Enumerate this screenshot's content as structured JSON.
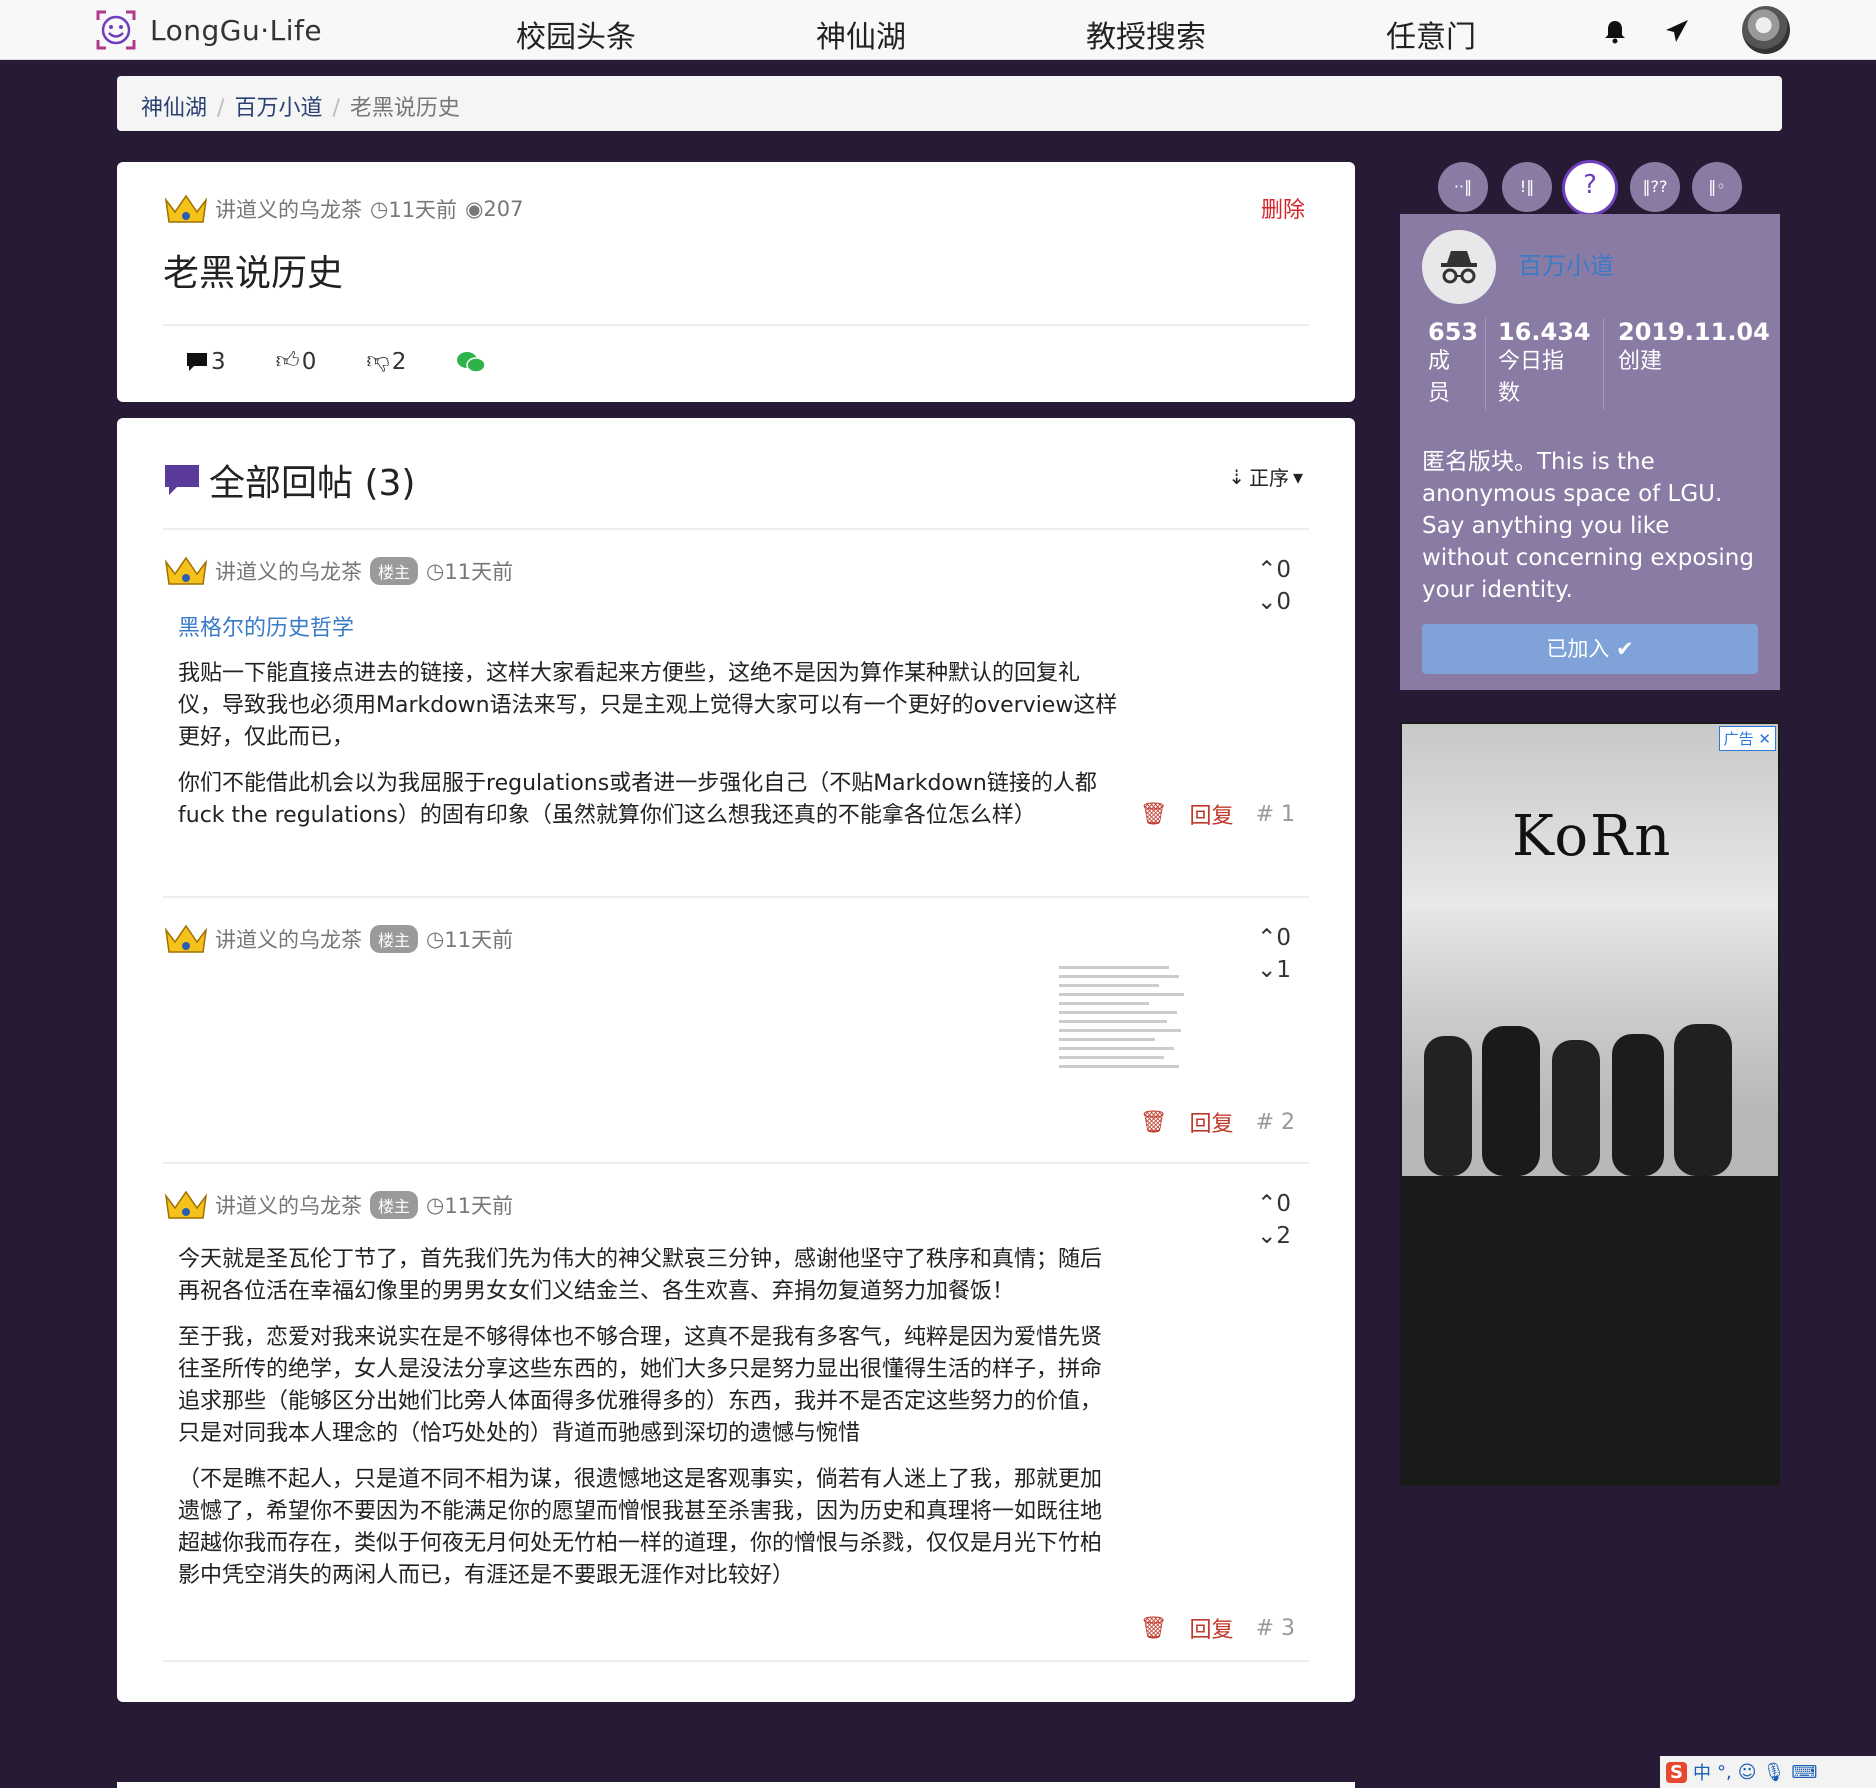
{
  "brand": {
    "name": "LongGu·Life"
  },
  "nav": {
    "links": [
      "校园头条",
      "神仙湖",
      "教授搜索",
      "任意门"
    ],
    "icons": [
      "bell-icon",
      "send-icon"
    ]
  },
  "breadcrumb": [
    "神仙湖",
    "百万小道",
    "老黑说历史"
  ],
  "post": {
    "author": "讲道义的乌龙茶",
    "time": "11天前",
    "views": "207",
    "delete_label": "删除",
    "title": "老黑说历史",
    "comments": "3",
    "likes": "0",
    "dislikes": "2"
  },
  "replies_section": {
    "title": "全部回帖 (3)",
    "sort_label": "正序"
  },
  "replies": [
    {
      "author": "讲道义的乌龙茶",
      "badge": "楼主",
      "time": "11天前",
      "up": "0",
      "down": "0",
      "link": "黑格尔的历史哲学",
      "paragraphs": [
        "我贴一下能直接点进去的链接，这样大家看起来方便些，这绝不是因为算作某种默认的回复礼仪，导致我也必须用Markdown语法来写，只是主观上觉得大家可以有一个更好的overview这样更好，仅此而已，",
        "你们不能借此机会以为我屈服于regulations或者进一步强化自己（不贴Markdown链接的人都fuck the regulations）的固有印象（虽然就算你们这么想我还真的不能拿各位怎么样）"
      ],
      "reply_label": "回复",
      "number": "# 1"
    },
    {
      "author": "讲道义的乌龙茶",
      "badge": "楼主",
      "time": "11天前",
      "up": "0",
      "down": "1",
      "reply_label": "回复",
      "number": "# 2"
    },
    {
      "author": "讲道义的乌龙茶",
      "badge": "楼主",
      "time": "11天前",
      "up": "0",
      "down": "2",
      "paragraphs": [
        "今天就是圣瓦伦丁节了，首先我们先为伟大的神父默哀三分钟，感谢他坚守了秩序和真情；随后再祝各位活在幸福幻像里的男男女女们义结金兰、各生欢喜、弃捐勿复道努力加餐饭！",
        "至于我，恋爱对我来说实在是不够得体也不够合理，这真不是我有多客气，纯粹是因为爱惜先贤往圣所传的绝学，女人是没法分享这些东西的，她们大多只是努力显出很懂得生活的样子，拼命追求那些（能够区分出她们比旁人体面得多优雅得多的）东西，我并不是否定这些努力的价值，只是对同我本人理念的（恰巧处处的）背道而驰感到深切的遗憾与惋惜",
        "（不是瞧不起人，只是道不同不相为谋，很遗憾地这是客观事实，倘若有人迷上了我，那就更加遗憾了，希望你不要因为不能满足你的愿望而憎恨我甚至杀害我，因为历史和真理将一如既往地超越你我而存在，类似于何夜无月何处无竹柏一样的道理，你的憎恨与杀戮，仅仅是月光下竹柏影中凭空消失的两闲人而已，有涯还是不要跟无涯作对比较好）"
      ],
      "reply_label": "回复",
      "number": "# 3"
    }
  ],
  "board": {
    "name": "百万小道",
    "stats": [
      {
        "value": "653",
        "label": "成员"
      },
      {
        "value": "16.434",
        "label": "今日指数"
      },
      {
        "value": "2019.11.04",
        "label": "创建"
      }
    ],
    "description": "匿名版块。This is the anonymous space of LGU. Say anything you like without concerning exposing your identity.",
    "join_label": "已加入",
    "tabs": [
      "··‖",
      "!‖",
      "?",
      "‖??",
      "‖◦"
    ]
  },
  "ad": {
    "label": "广告",
    "logo_text": "KoRn"
  },
  "taskbar": {
    "ime": "中"
  },
  "colors": {
    "background": "#261a34",
    "board_card": "#8a7ba4",
    "accent_link": "#3a7bc8",
    "danger": "#c0392b"
  }
}
